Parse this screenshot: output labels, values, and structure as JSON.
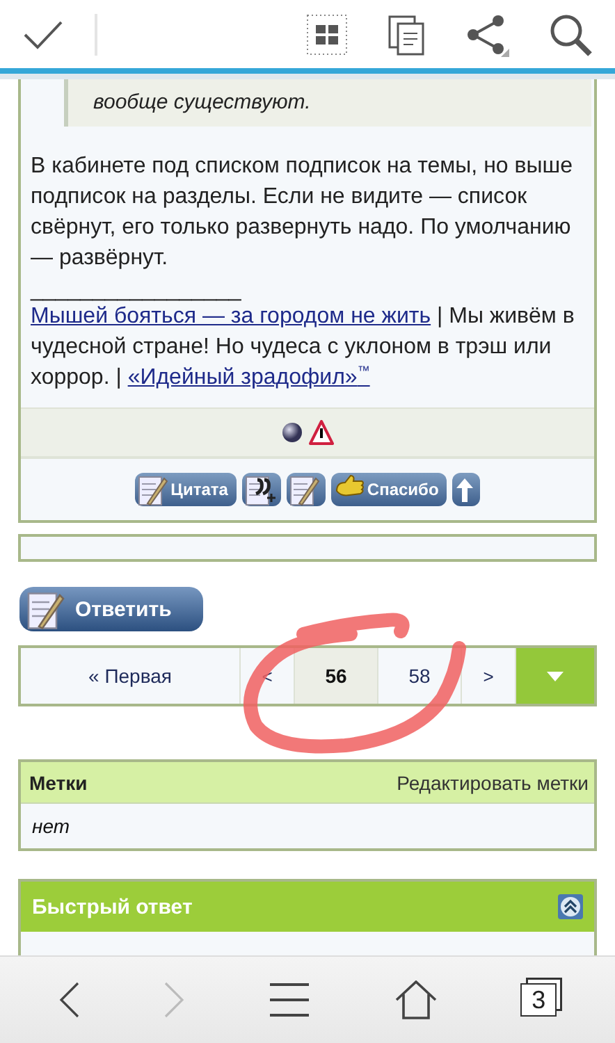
{
  "quote": {
    "text": "вообще существуют."
  },
  "post": {
    "body": "В кабинете под списком подписок на темы, но выше подписок на разделы. Если не видите — список свёрнут, его только развернуть надо. По умолчанию — развёрнут.",
    "signature_rule": "_________________",
    "signature": [
      {
        "text": "Мышей бояться — за городом не жить",
        "link": true
      },
      {
        "text": " | Мы живём в чудесной стране! Но чудеса с уклоном в трэш или хоррор. | ",
        "link": false
      },
      {
        "text": "«Идейный зрадофил»$^{™}$",
        "link": true
      }
    ]
  },
  "action_buttons": [
    {
      "kind": "quote",
      "label": "Цитата"
    },
    {
      "kind": "multiquote"
    },
    {
      "kind": "edit"
    },
    {
      "kind": "thanks",
      "label": "Спасибо"
    },
    {
      "kind": "top"
    }
  ],
  "reply_button": {
    "label": "Ответить"
  },
  "pagination": [
    {
      "kind": "link",
      "label": "« Первая"
    },
    {
      "kind": "link",
      "label": "<"
    },
    {
      "kind": "page",
      "label": "56",
      "selected": true
    },
    {
      "kind": "page",
      "label": "58",
      "selected": false
    },
    {
      "kind": "link",
      "label": ">"
    },
    {
      "kind": "menu"
    }
  ],
  "tags": {
    "title": "Метки",
    "action": "Редактировать метки",
    "value": "нет"
  },
  "quick_reply": {
    "title": "Быстрый ответ"
  },
  "bottom_nav": {
    "back_enabled": true,
    "forward_enabled": false,
    "tab_count": "3"
  }
}
